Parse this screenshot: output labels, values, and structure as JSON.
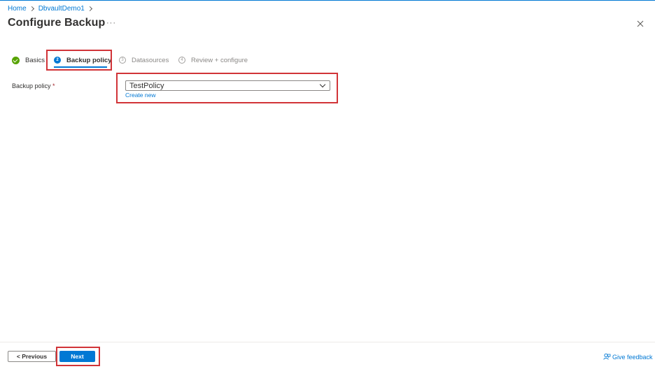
{
  "breadcrumb": {
    "home": "Home",
    "vault": "DbvaultDemo1"
  },
  "page": {
    "title": "Configure Backup",
    "more": "···"
  },
  "tabs": [
    {
      "number": "",
      "label": "Basics",
      "state": "completed"
    },
    {
      "number": "2",
      "label": "Backup policy",
      "state": "active"
    },
    {
      "number": "3",
      "label": "Datasources",
      "state": "disabled"
    },
    {
      "number": "4",
      "label": "Review + configure",
      "state": "disabled"
    }
  ],
  "form": {
    "policy_label": "Backup policy",
    "required_marker": "*",
    "policy_value": "TestPolicy",
    "create_new": "Create new"
  },
  "footer": {
    "previous": "< Previous",
    "next": "Next",
    "feedback": "Give feedback"
  },
  "colors": {
    "accent": "#0078d4",
    "success": "#57a300",
    "highlight": "#d13438"
  }
}
